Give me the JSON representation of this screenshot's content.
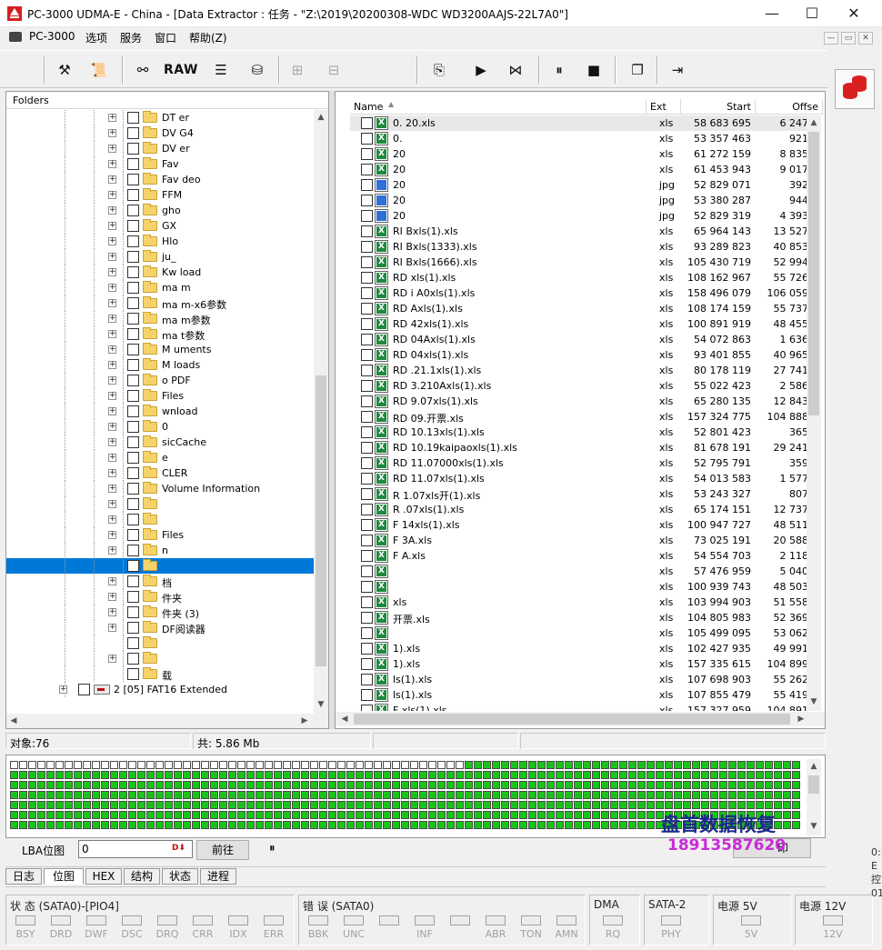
{
  "window": {
    "title": "PC-3000 UDMA-E - China - [Data Extractor : 任务 - \"Z:\\2019\\20200308-WDC WD3200AAJS-22L7A0\"]",
    "minimize": "—",
    "maximize": "☐",
    "close": "✕"
  },
  "menu": {
    "items": [
      "PC-3000",
      "选项",
      "服务",
      "窗口",
      "帮助(Z)"
    ],
    "mdi": [
      "—",
      "▭",
      "✕"
    ]
  },
  "toolbar": {
    "raw_label": "RAW",
    "icons": [
      "tools-icon",
      "scroll-icon",
      "binoculars-icon",
      "raw-icon",
      "stack-icon",
      "disk-icon",
      "tree-icon",
      "cluster-icon",
      "export-icon",
      "play-icon",
      "play-tree-icon",
      "pause-icon",
      "stop-icon",
      "windows-icon",
      "exit-icon"
    ]
  },
  "folders": {
    "header": "Folders",
    "rows": [
      {
        "label": "DT      er",
        "exp": true
      },
      {
        "label": "DV      G4",
        "exp": true
      },
      {
        "label": "DV      er",
        "exp": true
      },
      {
        "label": "Fav",
        "exp": true
      },
      {
        "label": "Fav      deo",
        "exp": true
      },
      {
        "label": "FFM",
        "exp": true
      },
      {
        "label": "gho",
        "exp": true
      },
      {
        "label": "GX",
        "exp": true
      },
      {
        "label": "Hlo",
        "exp": true
      },
      {
        "label": "ju_",
        "exp": true
      },
      {
        "label": "Kw      load",
        "exp": true
      },
      {
        "label": "ma      m",
        "exp": true
      },
      {
        "label": "ma      m-x6参数",
        "exp": true
      },
      {
        "label": "ma      m参数",
        "exp": true
      },
      {
        "label": "ma      t参数",
        "exp": true
      },
      {
        "label": "M       uments",
        "exp": true
      },
      {
        "label": "M       loads",
        "exp": true
      },
      {
        "label": "o        PDF",
        "exp": true
      },
      {
        "label": "         Files",
        "exp": true
      },
      {
        "label": "         wnload",
        "exp": true
      },
      {
        "label": "         0",
        "exp": true
      },
      {
        "label": "         sicCache",
        "exp": true
      },
      {
        "label": "         e",
        "exp": true
      },
      {
        "label": "         CLER",
        "exp": true
      },
      {
        "label": "           Volume Information",
        "exp": true
      },
      {
        "label": "",
        "exp": true
      },
      {
        "label": "",
        "exp": true
      },
      {
        "label": "         Files",
        "exp": true
      },
      {
        "label": "         n",
        "exp": true
      },
      {
        "label": "",
        "exp": false,
        "selected": true
      },
      {
        "label": "         档",
        "exp": true
      },
      {
        "label": "         件夹",
        "exp": true
      },
      {
        "label": "         件夹 (3)",
        "exp": true
      },
      {
        "label": "         DF阅读器",
        "exp": true
      },
      {
        "label": "",
        "exp": false
      },
      {
        "label": "",
        "exp": true
      },
      {
        "label": "         载",
        "exp": false
      }
    ],
    "partition_label": "2 [05] FAT16 Extended"
  },
  "filelist": {
    "columns": [
      "Name",
      "Ext",
      "Start",
      "Offse"
    ],
    "rows": [
      {
        "name": "0.            20.xls",
        "ext": "xls",
        "start": "58 683 695",
        "offset": "6 247"
      },
      {
        "name": "0.",
        "ext": "xls",
        "start": "53 357 463",
        "offset": "921"
      },
      {
        "name": "20",
        "ext": "xls",
        "start": "61 272 159",
        "offset": "8 835"
      },
      {
        "name": "20",
        "ext": "xls",
        "start": "61 453 943",
        "offset": "9 017"
      },
      {
        "name": "20",
        "ext": "jpg",
        "start": "52 829 071",
        "offset": "392"
      },
      {
        "name": "20",
        "ext": "jpg",
        "start": "53 380 287",
        "offset": "944"
      },
      {
        "name": "20",
        "ext": "jpg",
        "start": "52 829 319",
        "offset": "4 393"
      },
      {
        "name": "RI                  Bxls(1).xls",
        "ext": "xls",
        "start": "65 964 143",
        "offset": "13 527"
      },
      {
        "name": "RI                  Bxls(1333).xls",
        "ext": "xls",
        "start": "93 289 823",
        "offset": "40 853"
      },
      {
        "name": "RI                  Bxls(1666).xls",
        "ext": "xls",
        "start": "105 430 719",
        "offset": "52 994"
      },
      {
        "name": "RD                  xls(1).xls",
        "ext": "xls",
        "start": "108 162 967",
        "offset": "55 726"
      },
      {
        "name": "RD              i   A0xls(1).xls",
        "ext": "xls",
        "start": "158 496 079",
        "offset": "106 059"
      },
      {
        "name": "RD                  Axls(1).xls",
        "ext": "xls",
        "start": "108 174 159",
        "offset": "55 737"
      },
      {
        "name": "RD                 42xls(1).xls",
        "ext": "xls",
        "start": "100 891 919",
        "offset": "48 455"
      },
      {
        "name": "RD                 04Axls(1).xls",
        "ext": "xls",
        "start": "54 072 863",
        "offset": "1 636"
      },
      {
        "name": "RD                 04xls(1).xls",
        "ext": "xls",
        "start": "93 401 855",
        "offset": "40 965"
      },
      {
        "name": "RD               .21.1xls(1).xls",
        "ext": "xls",
        "start": "80 178 119",
        "offset": "27 741"
      },
      {
        "name": "RD               3.210Axls(1).xls",
        "ext": "xls",
        "start": "55 022 423",
        "offset": "2 586"
      },
      {
        "name": "RD                9.07xls(1).xls",
        "ext": "xls",
        "start": "65 280 135",
        "offset": "12 843"
      },
      {
        "name": "RD               09.开票.xls",
        "ext": "xls",
        "start": "157 324 775",
        "offset": "104 888"
      },
      {
        "name": "RD                10.13xls(1).xls",
        "ext": "xls",
        "start": "52 801 423",
        "offset": "365"
      },
      {
        "name": "RD                10.19kaipaoxls(1).xls",
        "ext": "xls",
        "start": "81 678 191",
        "offset": "29 241"
      },
      {
        "name": "RD                11.07000xls(1).xls",
        "ext": "xls",
        "start": "52 795 791",
        "offset": "359"
      },
      {
        "name": "RD                11.07xls(1).xls",
        "ext": "xls",
        "start": "54 013 583",
        "offset": "1 577"
      },
      {
        "name": "R                 1.07xls开(1).xls",
        "ext": "xls",
        "start": "53 243 327",
        "offset": "807"
      },
      {
        "name": "R                 .07xls(1).xls",
        "ext": "xls",
        "start": "65 174 151",
        "offset": "12 737"
      },
      {
        "name": "F                 14xls(1).xls",
        "ext": "xls",
        "start": "100 947 727",
        "offset": "48 511"
      },
      {
        "name": "F                 3A.xls",
        "ext": "xls",
        "start": "73 025 191",
        "offset": "20 588"
      },
      {
        "name": "F                 A.xls",
        "ext": "xls",
        "start": "54 554 703",
        "offset": "2 118"
      },
      {
        "name": "",
        "ext": "xls",
        "start": "57 476 959",
        "offset": "5 040"
      },
      {
        "name": "",
        "ext": "xls",
        "start": "100 939 743",
        "offset": "48 503"
      },
      {
        "name": "                  xls",
        "ext": "xls",
        "start": "103 994 903",
        "offset": "51 558"
      },
      {
        "name": "                  开票.xls",
        "ext": "xls",
        "start": "104 805 983",
        "offset": "52 369"
      },
      {
        "name": "",
        "ext": "xls",
        "start": "105 499 095",
        "offset": "53 062"
      },
      {
        "name": "                 1).xls",
        "ext": "xls",
        "start": "102 427 935",
        "offset": "49 991"
      },
      {
        "name": "                 1).xls",
        "ext": "xls",
        "start": "157 335 615",
        "offset": "104 899"
      },
      {
        "name": "                 ls(1).xls",
        "ext": "xls",
        "start": "107 698 903",
        "offset": "55 262"
      },
      {
        "name": "                 ls(1).xls",
        "ext": "xls",
        "start": "107 855 479",
        "offset": "55 419"
      },
      {
        "name": "F                xls(1).xls",
        "ext": "xls",
        "start": "157 327 959",
        "offset": "104 891"
      }
    ]
  },
  "status": {
    "objects": "对象:76",
    "total": "共: 5.86 Mb"
  },
  "lba_map": {
    "cols": 87,
    "rows": 7,
    "unread_cells_first_row": 50,
    "watermark_line1": "盘首数据恢复",
    "watermark_line2": "18913587620",
    "watermark_color1": "#1a2a8a",
    "watermark_color2": "#c82bd8"
  },
  "lba_controls": {
    "label": "LBA位图",
    "value": "0",
    "goto_label": "前往",
    "pause_label": "⏸",
    "right_button_label": "印"
  },
  "tabs": [
    "日志",
    "位图",
    "HEX",
    "结构",
    "状态",
    "进程"
  ],
  "active_tab": "位图",
  "indicators": {
    "status_title": "状 态 (SATA0)-[PIO4]",
    "status_leds": [
      "BSY",
      "DRD",
      "DWF",
      "DSC",
      "DRQ",
      "CRR",
      "IDX",
      "ERR"
    ],
    "error_title": "错 误 (SATA0)",
    "error_leds": [
      "BBK",
      "UNC",
      "",
      "INF",
      "",
      "ABR",
      "TON",
      "AMN"
    ],
    "dma_title": "DMA",
    "dma_led": "RQ",
    "sata_title": "SATA-2",
    "sata_led": "PHY",
    "p5_title": "电源 5V",
    "p5_led": "5V",
    "p12_title": "电源 12V",
    "p12_led": "12V"
  },
  "right_edge": {
    "line1": "0:",
    "line2": "E",
    "line3": "控",
    "line4": "01"
  },
  "colors": {
    "selection": "#0078d7",
    "lba_read": "#19c419"
  }
}
